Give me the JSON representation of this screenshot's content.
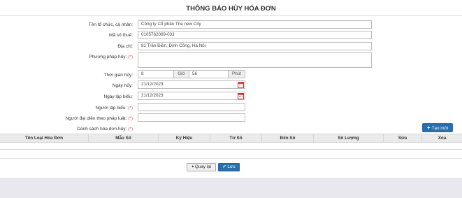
{
  "title": "THÔNG BÁO HỦY HÓA ĐƠN",
  "form": {
    "org_label": "Tên tổ chức, cá nhân:",
    "org_value": "Công ty Cổ phần The new City",
    "tax_label": "Mã số thuế:",
    "tax_value": "0105762069-033",
    "address_label": "Địa chỉ:",
    "address_value": "81 Trần Điền, Định Công, Hà Nội",
    "method_label": "Phương pháp hủy:",
    "method_value": "",
    "time_label": "Thời gian hủy:",
    "hour_value": "8",
    "hour_unit": "Giờ",
    "minute_value": "56",
    "minute_unit": "Phút",
    "cancel_date_label": "Ngày hủy:",
    "cancel_date_value": "21/12/2023",
    "create_date_label": "Ngày lập biểu:",
    "create_date_value": "21/12/2023",
    "creator_label": "Người lập biểu:",
    "creator_value": "",
    "legal_rep_label": "Người đại diện theo pháp luật:",
    "legal_rep_value": "",
    "invoice_list_label": "Danh sách hóa đơn hủy:",
    "required_mark": "(*)"
  },
  "new_button": "Tạo mới",
  "table": {
    "columns": [
      "Tên Loại Hóa Đơn",
      "Mẫu Số",
      "Ký Hiệu",
      "Từ Số",
      "Đến Số",
      "Số Lượng",
      "Sửa",
      "Xóa"
    ]
  },
  "actions": {
    "back": "Quay lại",
    "save": "Lưu"
  },
  "colors": {
    "primary": "#2a6fad",
    "required": "#d9534f",
    "header_bg": "#eaeaea",
    "footer_bg": "#e8e8ee"
  },
  "icons": {
    "calendar": "calendar-icon",
    "plus": "plus-icon",
    "back": "arrow-left-icon",
    "save": "check-icon"
  }
}
